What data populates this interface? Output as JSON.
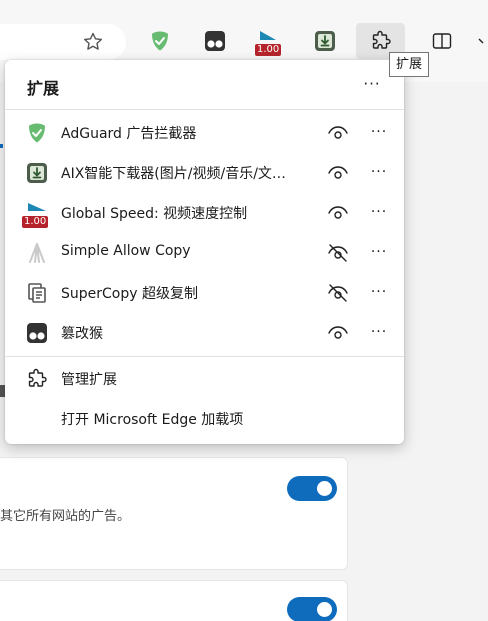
{
  "toolbar": {
    "extensions_tooltip": "扩展",
    "global_speed_badge": "1.00"
  },
  "panel": {
    "title": "扩展",
    "more_icon": "···",
    "extensions": [
      {
        "name": "AdGuard 广告拦截器",
        "icon": "adguard-shield-icon",
        "visibility": "shown"
      },
      {
        "name": "AIX智能下载器(图片/视频/音乐/文…",
        "icon": "aix-download-icon",
        "visibility": "shown"
      },
      {
        "name": "Global Speed: 视频速度控制",
        "icon": "global-speed-icon",
        "visibility": "shown",
        "badge": "1.00"
      },
      {
        "name": "Simple Allow Copy",
        "icon": "simple-allow-copy-icon",
        "visibility": "hidden"
      },
      {
        "name": "SuperCopy 超级复制",
        "icon": "supercopy-icon",
        "visibility": "hidden"
      },
      {
        "name": "篡改猴",
        "icon": "tampermonkey-icon",
        "visibility": "shown"
      }
    ],
    "manage_label": "管理扩展",
    "get_addons_label": "打开 Microsoft Edge 加载项"
  },
  "background": {
    "ad_text": "其它所有网站的广告。"
  },
  "colors": {
    "accent": "#0f6cbd",
    "adguard_green": "#68bc71",
    "badge_red": "#b5242b"
  }
}
